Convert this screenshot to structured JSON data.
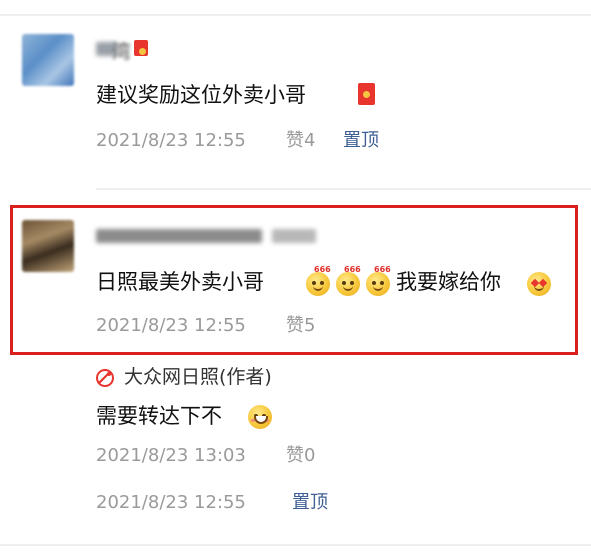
{
  "comments": [
    {
      "username_suffix": "湾",
      "text": "建议奖励这位外卖小哥",
      "timestamp": "2021/8/23 12:55",
      "likes": "赞4",
      "pin_label": "置顶",
      "emoji": [
        "red-envelope"
      ]
    },
    {
      "text": "日照最美外卖小哥",
      "text_suffix": "我要嫁给你",
      "timestamp": "2021/8/23 12:55",
      "likes": "赞5",
      "emoji": [
        "666-face",
        "666-face",
        "666-face",
        "heart-eyes-face"
      ],
      "highlighted": true
    }
  ],
  "reply": {
    "author": "大众网日照(作者)",
    "text": "需要转达下不",
    "timestamp": "2021/8/23 13:03",
    "likes": "赞0",
    "emoji": [
      "grinning-face"
    ]
  },
  "footer": {
    "timestamp": "2021/8/23 12:55",
    "pin_label": "置顶"
  },
  "colors": {
    "highlight_border": "#d9201d",
    "link_blue": "#3f5f94",
    "meta_gray": "#9a9a9a"
  }
}
